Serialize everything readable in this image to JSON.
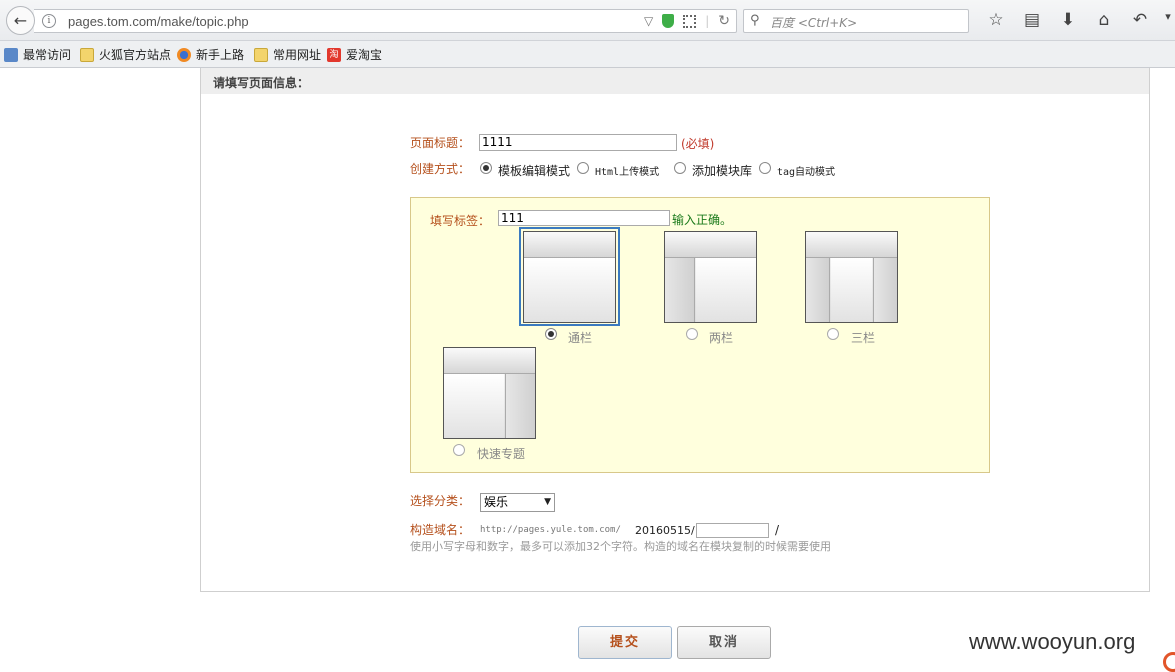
{
  "browser": {
    "url_display": "pages.tom.com/make/topic.php",
    "search_placeholder": "百度 <Ctrl+K>",
    "bookmarks": [
      "最常访问",
      "火狐官方站点",
      "新手上路",
      "常用网址",
      "爱淘宝"
    ]
  },
  "page": {
    "section_title": "请填写页面信息：",
    "title_label": "页面标题：",
    "title_value": "1111",
    "required_note": "(必填)",
    "create_label": "创建方式：",
    "create_modes": [
      "模板编辑模式",
      "Html上传模式",
      "添加模块库",
      "tag自动模式"
    ],
    "selected_mode": "模板编辑模式",
    "tag_label": "填写标签：",
    "tag_value": "111",
    "tag_ok": "输入正确。",
    "templates": [
      "通栏",
      "两栏",
      "三栏",
      "快速专题"
    ],
    "selected_template": "通栏",
    "category_label": "选择分类：",
    "category_value": "娱乐",
    "domain_label": "构造域名：",
    "domain_prefix": "http://pages.yule.tom.com/",
    "domain_date": "20160515/",
    "domain_suffix": "/",
    "domain_hint": "使用小写字母和数字，最多可以添加32个字符。构造的域名在模块复制的时候需要使用",
    "submit_label": "提交",
    "cancel_label": "取消"
  },
  "watermark": "www.wooyun.org"
}
